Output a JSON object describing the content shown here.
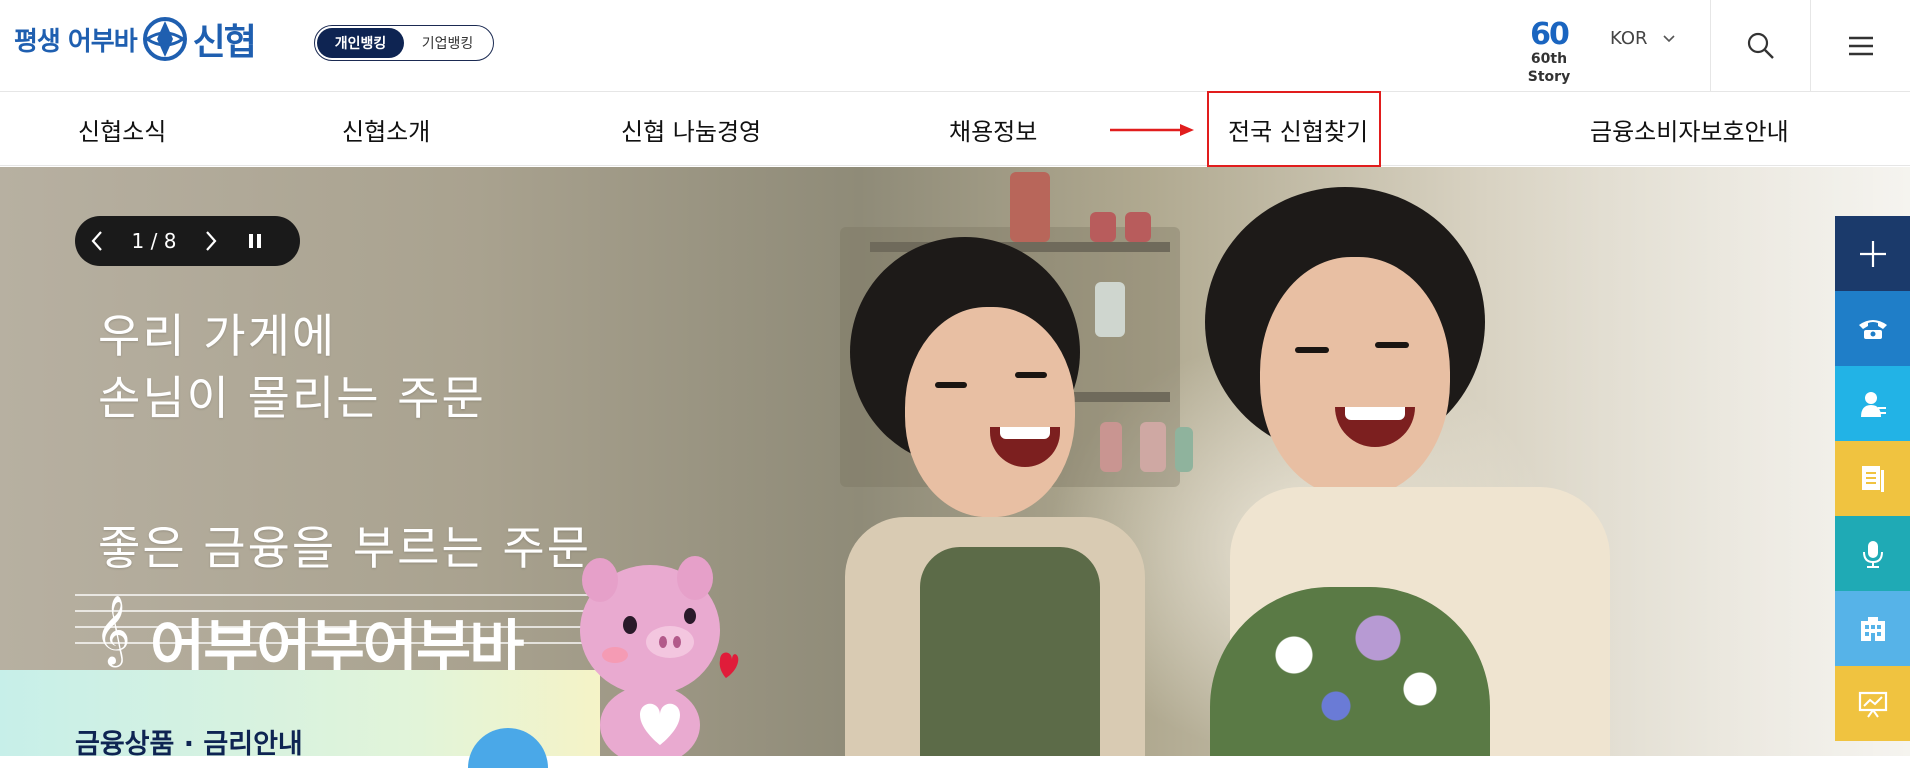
{
  "brand": {
    "slogan": "평생 어부바",
    "name": "신협"
  },
  "bank_toggle": {
    "personal": "개인뱅킹",
    "corporate": "기업뱅킹"
  },
  "story": {
    "number": "60",
    "label": "60th Story"
  },
  "language": {
    "selected": "KOR"
  },
  "nav": {
    "items": [
      {
        "label": "신협소식"
      },
      {
        "label": "신협소개"
      },
      {
        "label": "신협 나눔경영"
      },
      {
        "label": "채용정보"
      },
      {
        "label": "전국 신협찾기"
      },
      {
        "label": "금융소비자보호안내"
      }
    ],
    "highlighted": "전국 신협찾기"
  },
  "slider": {
    "counter": "1 / 8"
  },
  "hero": {
    "line1": "우리 가게에",
    "line2": "손님이 몰리는 주문",
    "line3": "좋은 금융을 부르는 주문",
    "brand_text": "어부어부어부바"
  },
  "product": {
    "label": "금융상품 · 금리안내"
  },
  "quick_menu": [
    {
      "icon": "plus-icon",
      "color": "#1b3a6b"
    },
    {
      "icon": "phone-icon",
      "color": "#1f7ec8"
    },
    {
      "icon": "counselor-icon",
      "color": "#22b3e6"
    },
    {
      "icon": "document-icon",
      "color": "#f0c340"
    },
    {
      "icon": "microphone-icon",
      "color": "#1faab5"
    },
    {
      "icon": "building-icon",
      "color": "#56b3e8"
    },
    {
      "icon": "presentation-icon",
      "color": "#f0c340"
    }
  ],
  "colors": {
    "brand_blue": "#1f5fb0",
    "navy": "#0e2452",
    "highlight_red": "#e11d1d"
  }
}
